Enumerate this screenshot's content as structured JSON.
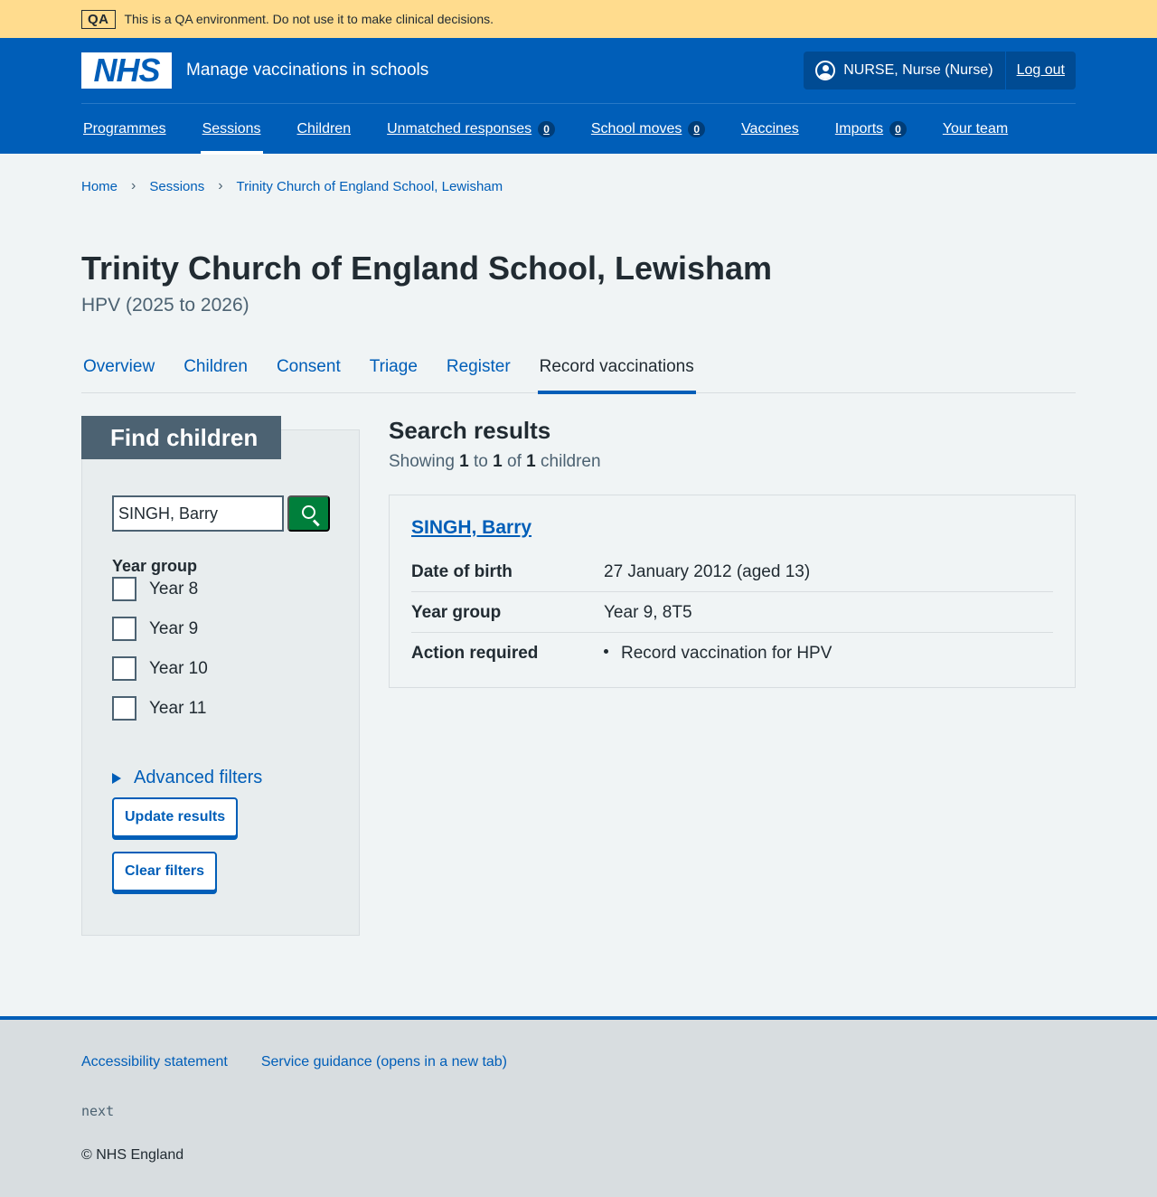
{
  "qa_banner": {
    "tag": "QA",
    "message": "This is a QA environment. Do not use it to make clinical decisions."
  },
  "header": {
    "logo_text": "NHS",
    "service_name": "Manage vaccinations in schools",
    "user_name": "NURSE, Nurse (Nurse)",
    "logout_label": "Log out",
    "icons": {
      "user": "user-icon"
    }
  },
  "nav": {
    "items": [
      {
        "label": "Programmes"
      },
      {
        "label": "Sessions"
      },
      {
        "label": "Children"
      },
      {
        "label": "Unmatched responses",
        "count": "0"
      },
      {
        "label": "School moves",
        "count": "0"
      },
      {
        "label": "Vaccines"
      },
      {
        "label": "Imports",
        "count": "0"
      },
      {
        "label": "Your team"
      }
    ],
    "active": "Sessions"
  },
  "breadcrumb": {
    "items": [
      "Home",
      "Sessions",
      "Trinity Church of England School, Lewisham"
    ],
    "separator": "›"
  },
  "page": {
    "title": "Trinity Church of England School, Lewisham",
    "caption": "HPV (2025 to 2026)"
  },
  "tabs": {
    "items": [
      "Overview",
      "Children",
      "Consent",
      "Triage",
      "Register",
      "Record vaccinations"
    ],
    "active": "Record vaccinations"
  },
  "filters": {
    "heading": "Find children",
    "search_value": "SINGH, Barry",
    "year_group_label": "Year group",
    "year_options": [
      "Year 8",
      "Year 9",
      "Year 10",
      "Year 11"
    ],
    "advanced_label": "Advanced filters",
    "update_label": "Update results",
    "clear_label": "Clear filters",
    "icons": {
      "search": "search-icon",
      "disclosure": "triangle-right-icon"
    }
  },
  "results": {
    "heading": "Search results",
    "showing": {
      "prefix": "Showing",
      "from": "1",
      "to_word": "to",
      "to": "1",
      "of_word": "of",
      "total": "1",
      "suffix": "children"
    },
    "card": {
      "name": "SINGH, Barry",
      "rows": [
        {
          "key": "Date of birth",
          "value": "27 January 2012 (aged 13)"
        },
        {
          "key": "Year group",
          "value": "Year 9, 8T5"
        },
        {
          "key": "Action required",
          "value": "Record vaccination for HPV"
        }
      ]
    }
  },
  "footer": {
    "links": [
      "Accessibility statement",
      "Service guidance (opens in a new tab)"
    ],
    "version": "next",
    "copyright": "© NHS England"
  },
  "colors": {
    "brand_blue": "#005eb8",
    "qa_banner": "#ffdc8e",
    "search_button": "#007f3b",
    "filter_heading": "#4c6272"
  }
}
